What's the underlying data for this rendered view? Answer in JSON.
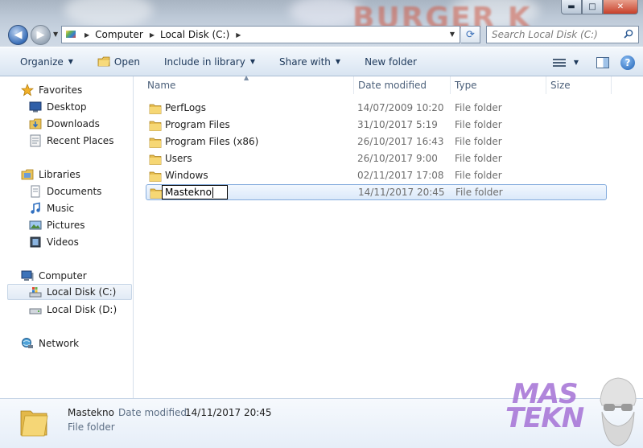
{
  "window": {
    "background_sign": "BURGER K",
    "caption": {
      "minimize": "▬",
      "maximize": "□",
      "close": "✕"
    }
  },
  "address": {
    "breadcrumbs": [
      "Computer",
      "Local Disk (C:)"
    ],
    "search_placeholder": "Search Local Disk (C:)"
  },
  "toolbar": {
    "organize": "Organize",
    "open": "Open",
    "include_in_library": "Include in library",
    "share_with": "Share with",
    "new_folder": "New folder"
  },
  "navpane": {
    "favorites": {
      "label": "Favorites",
      "items": [
        "Desktop",
        "Downloads",
        "Recent Places"
      ]
    },
    "libraries": {
      "label": "Libraries",
      "items": [
        "Documents",
        "Music",
        "Pictures",
        "Videos"
      ]
    },
    "computer": {
      "label": "Computer",
      "items": [
        "Local Disk (C:)",
        "Local Disk (D:)"
      ]
    },
    "network": {
      "label": "Network"
    }
  },
  "columns": {
    "name": "Name",
    "date_modified": "Date modified",
    "type": "Type",
    "size": "Size"
  },
  "files": [
    {
      "name": "PerfLogs",
      "date": "14/07/2009 10:20",
      "type": "File folder"
    },
    {
      "name": "Program Files",
      "date": "31/10/2017 5:19",
      "type": "File folder"
    },
    {
      "name": "Program Files (x86)",
      "date": "26/10/2017 16:43",
      "type": "File folder"
    },
    {
      "name": "Users",
      "date": "26/10/2017 9:00",
      "type": "File folder"
    },
    {
      "name": "Windows",
      "date": "02/11/2017 17:08",
      "type": "File folder"
    },
    {
      "name": "Mastekno",
      "date": "14/11/2017 20:45",
      "type": "File folder"
    }
  ],
  "details": {
    "name": "Mastekno",
    "date_label": "Date modified:",
    "date_value": "14/11/2017 20:45",
    "type": "File folder"
  },
  "watermark": {
    "line1": "MAS",
    "line2": "TEKN"
  }
}
